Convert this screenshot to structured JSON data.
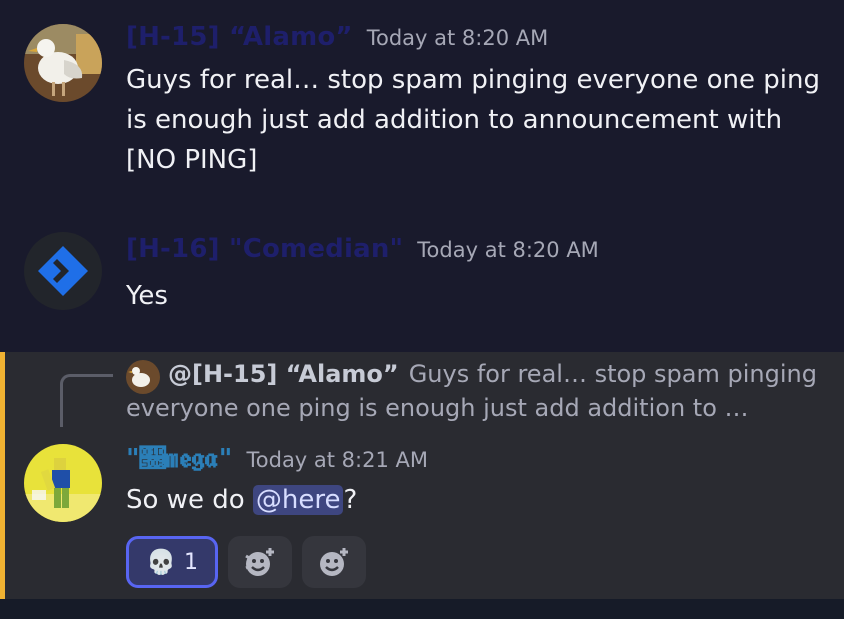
{
  "messages": [
    {
      "author": "[H-15] “Alamo”",
      "author_color": "#1e1f6b",
      "timestamp": "Today at 8:20 AM",
      "line1": "Guys for real… stop spam pinging everyone one ping",
      "line2": "is enough just add addition to announcement with",
      "line3": "[NO PING]",
      "avatar_icon": "seagull-avatar"
    },
    {
      "author": "[H-16] \"Comedian\"",
      "author_color": "#1e1f6b",
      "timestamp": "Today at 8:20 AM",
      "text": "Yes",
      "avatar_icon": "chevron-logo-avatar"
    },
    {
      "reply": {
        "author": "@[H-15] “Alamo”",
        "text_line1": "Guys for real… stop spam pinging",
        "text_line2": "everyone one ping is enough just add addition to …"
      },
      "author": "\"𝔆𝔪𝔢𝔤𝔞\"",
      "author_color": "#2b7fb8",
      "timestamp": "Today at 8:21 AM",
      "text_before": "So we do ",
      "mention": "@here",
      "text_after": "?",
      "avatar_icon": "roblox-character-avatar",
      "reactions": [
        {
          "icon": "skull-icon",
          "emoji": "💀",
          "count": "1",
          "active": true
        },
        {
          "icon": "add-super-reaction-icon"
        },
        {
          "icon": "add-reaction-icon"
        }
      ]
    }
  ],
  "colors": {
    "background": "#191a2c",
    "highlight_background": "#2a2b31",
    "highlight_bar": "#f0b232",
    "mention_pill": "#3e4680",
    "reaction_active_border": "#5865f2"
  }
}
